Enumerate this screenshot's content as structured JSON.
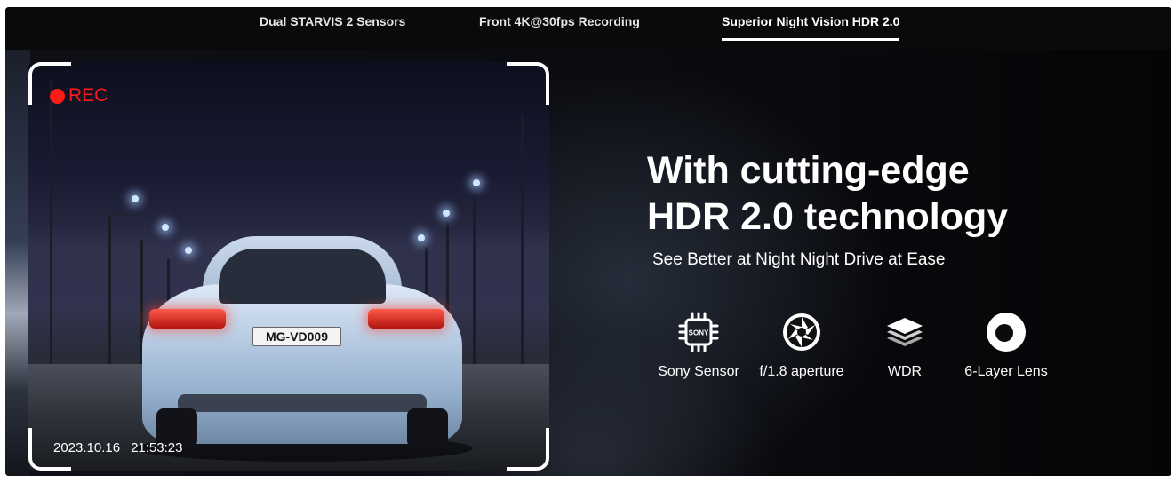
{
  "tabs": [
    {
      "label": "Dual STARVIS 2 Sensors",
      "active": false
    },
    {
      "label": "Front 4K@30fps Recording",
      "active": false
    },
    {
      "label": "Superior Night Vision HDR 2.0",
      "active": true
    }
  ],
  "camera": {
    "rec_label": "REC",
    "plate": "MG-VD009",
    "date": "2023.10.16",
    "time": "21:53:23"
  },
  "hero": {
    "headline_line1": "With cutting-edge",
    "headline_line2": "HDR 2.0 technology",
    "subline": "See Better at Night Night Drive at Ease"
  },
  "features": [
    {
      "label": "Sony Sensor",
      "icon": "chip-icon",
      "chip_text": "SONY"
    },
    {
      "label": "f/1.8 aperture",
      "icon": "aperture-icon"
    },
    {
      "label": "WDR",
      "icon": "layers-icon"
    },
    {
      "label": "6-Layer Lens",
      "icon": "lens-ring-icon"
    }
  ],
  "colors": {
    "rec": "#ff1a1a",
    "background": "#0b0b0d",
    "text": "#ffffff"
  }
}
